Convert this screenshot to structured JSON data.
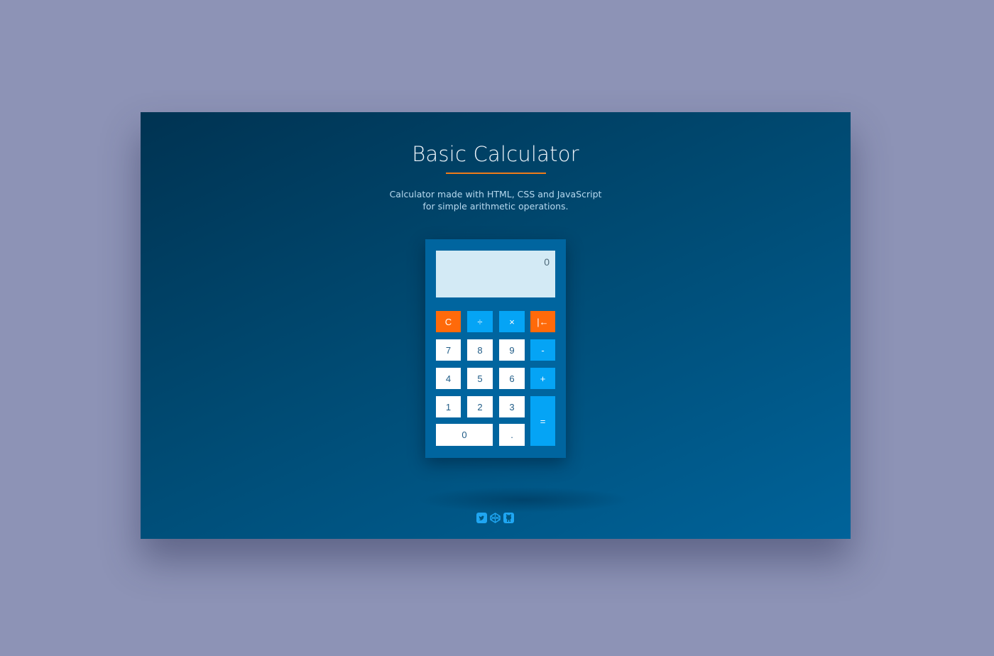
{
  "header": {
    "title": "Basic Calculator",
    "subtitle_line1": "Calculator made with HTML, CSS and JavaScript",
    "subtitle_line2": "for simple arithmetic operations."
  },
  "calculator": {
    "display_value": "0",
    "keys": {
      "clear": "C",
      "divide": "÷",
      "multiply": "×",
      "backspace": "|←",
      "seven": "7",
      "eight": "8",
      "nine": "9",
      "minus": "-",
      "four": "4",
      "five": "5",
      "six": "6",
      "plus": "+",
      "one": "1",
      "two": "2",
      "three": "3",
      "equals": "=",
      "zero": "0",
      "decimal": "."
    }
  },
  "footer": {
    "social_icons": [
      "twitter-icon",
      "codepen-icon",
      "github-icon"
    ]
  },
  "colors": {
    "page_background": "#8d93b6",
    "stage_gradient_start": "#003352",
    "stage_gradient_end": "#00639a",
    "calculator_body": "#00659f",
    "display_background": "#d3eaf5",
    "accent_orange": "#ff6a0a",
    "operator_blue": "#05a4f5",
    "underline": "#f07c1a"
  }
}
